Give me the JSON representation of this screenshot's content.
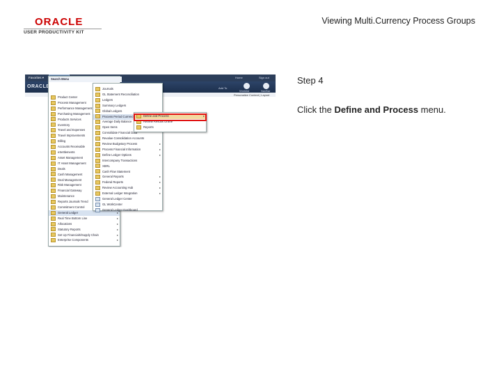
{
  "logo": {
    "brand": "ORACLE",
    "product": "USER PRODUCTIVITY KIT"
  },
  "page_title": "Viewing Multi.Currency Process Groups",
  "step": "Step 4",
  "instruction": {
    "prefix": "Click the ",
    "target": "Define and Process",
    "suffix": " menu."
  },
  "screenshot": {
    "tabs": [
      "Favorites ▾",
      "Main Menu"
    ],
    "oracle": "ORACLE",
    "header_links": [
      "Home",
      "Sign out",
      "Add To",
      "Worklist",
      "NavBar"
    ],
    "personalize": "Personalize Content | Layout",
    "nav_title": "Search Menu",
    "menu1": [
      "Product Center",
      "Process Management",
      "Performance Management",
      "Purchasing Management",
      "Products Services",
      "Inventory",
      "Travel and Expenses",
      "Travel Improvements",
      "Billing",
      "Accounts Receivable",
      "eSettlements",
      "Asset Management",
      "IT Asset Management",
      "Deals",
      "Cash Management",
      "Deal Management",
      "Risk Management",
      "Financial Gateway",
      "Maintenance",
      "Reports Journals Trend",
      "Commitment Control",
      "General Ledger",
      "Real Time Bottom Line",
      "Allocations",
      "Statutory Reports",
      "Set Up Financials/Supply Chain",
      "Enterprise Components"
    ],
    "menu2": [
      "Journals",
      "GL Statement Reconciliation",
      "Ledgers",
      "Summary Ledgers",
      "Global Ledgers",
      "Process Period Currency",
      "Average Daily Balance",
      "Open Items",
      "Consolidate Financial Data",
      "Revalue Consolidation Accounts",
      "Review Budgetary Process",
      "Process Financial Information",
      "Define Ledger Options",
      "Intercompany Transactions",
      "XBRL",
      "Cash Flow Statement",
      "General Reports",
      "Federal Reports",
      "Review Accounting Hub",
      "External Ledger Integration",
      "General Ledger Center",
      "GL WorkCenter",
      "General Ledger Dashboard"
    ],
    "menu3": [
      "Define and Process",
      "Review Results Online",
      "Reports"
    ]
  }
}
